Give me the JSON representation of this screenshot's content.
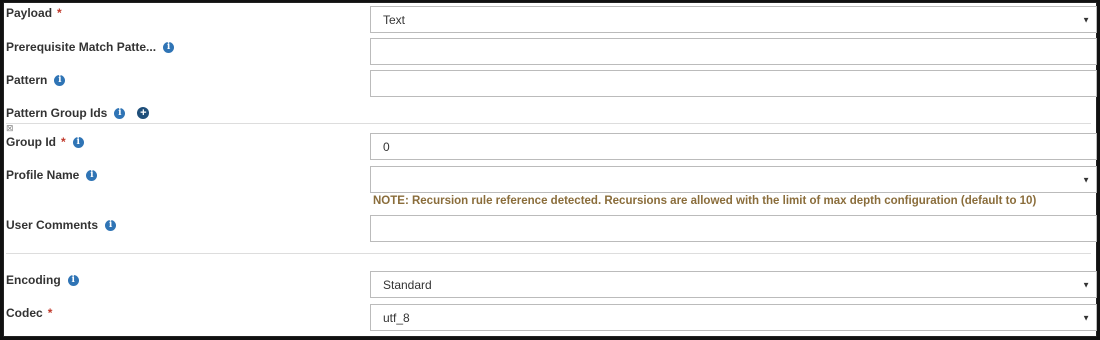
{
  "form": {
    "payload": {
      "label": "Payload",
      "required": "*",
      "value": "Text"
    },
    "prerequisite": {
      "label": "Prerequisite Match Patte...",
      "value": ""
    },
    "pattern": {
      "label": "Pattern",
      "value": ""
    },
    "pattern_group_ids": {
      "label": "Pattern Group Ids",
      "remove_glyph": "⊠"
    },
    "group_id": {
      "label": "Group Id",
      "required": "*",
      "value": "0"
    },
    "profile_name": {
      "label": "Profile Name",
      "value": ""
    },
    "note": "NOTE: Recursion rule reference detected. Recursions are allowed with the limit of max depth configuration (default to 10)",
    "user_comments": {
      "label": "User Comments",
      "value": ""
    },
    "encoding": {
      "label": "Encoding",
      "value": "Standard"
    },
    "codec": {
      "label": "Codec",
      "required": "*",
      "value": "utf_8"
    }
  },
  "icons": {
    "info": "info-icon",
    "add": "plus-circle-icon",
    "caret": "caret-down-icon",
    "remove": "remove-box-icon"
  },
  "colors": {
    "required": "#c0392b",
    "info_icon": "#2f74b5",
    "note_text": "#8a6d3b"
  }
}
